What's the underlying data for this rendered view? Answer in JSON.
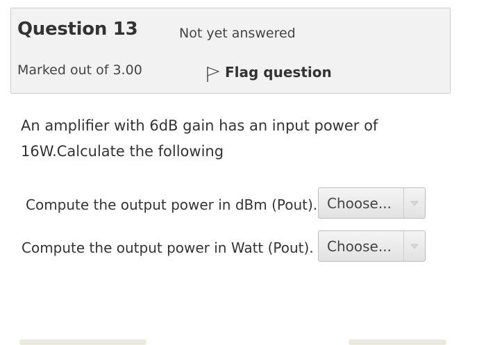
{
  "question": {
    "title": "Question 13",
    "state": "Not yet answered",
    "grade": "Marked out of 3.00",
    "flag_label": "Flag question"
  },
  "text_lines": [
    "An amplifier with 6dB gain has an input power of",
    "16W.Calculate the following"
  ],
  "subquestions": [
    {
      "label": "Compute the output power in dBm (Pout).",
      "select_value": "Choose..."
    },
    {
      "label": "Compute the output power in Watt (Pout).",
      "select_value": "Choose..."
    }
  ],
  "icons": {
    "flag": "flag-icon",
    "dropdown": "chevron-down-icon"
  }
}
